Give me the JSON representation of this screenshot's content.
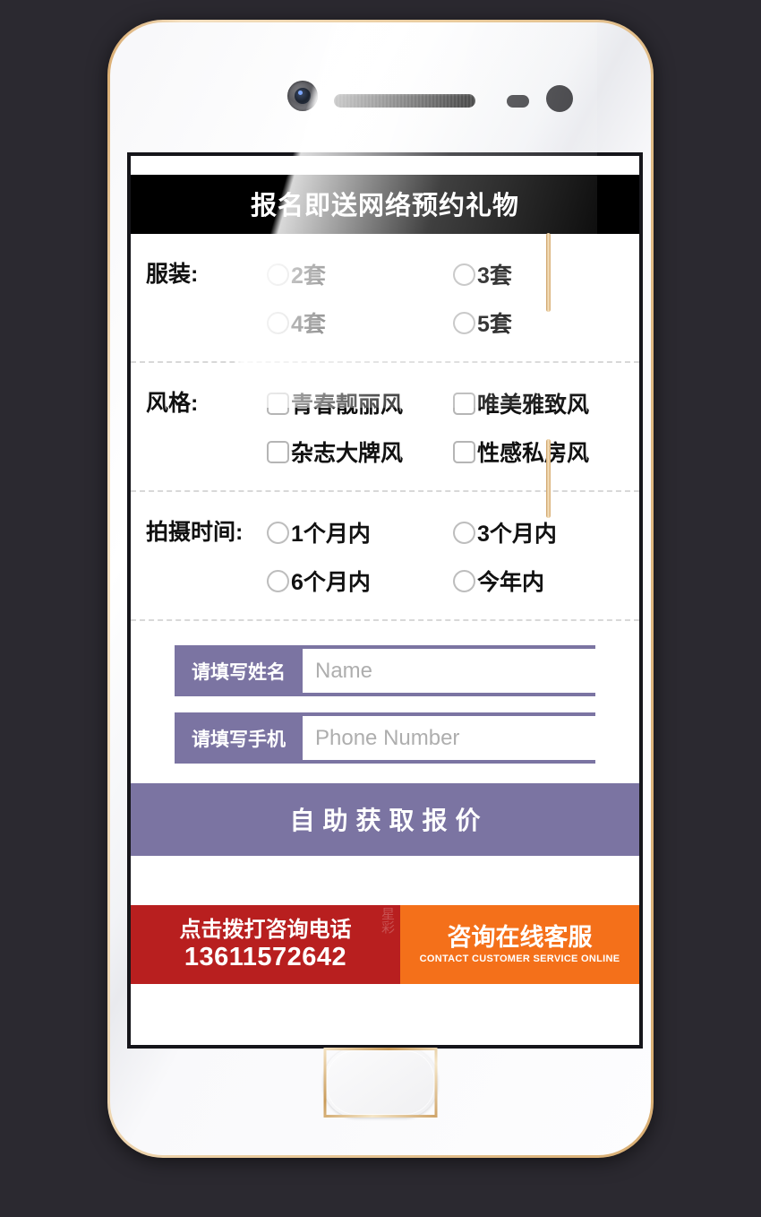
{
  "device": {
    "name": "white-gold-smartphone",
    "icons": {
      "front_camera": "camera-icon",
      "earpiece": "speaker-grille-icon",
      "proximity_sensor": "proximity-sensor-icon",
      "light_sensor": "light-sensor-icon",
      "home_button": "home-button-icon",
      "volume_up": "volume-up-button",
      "volume_down": "volume-down-button"
    }
  },
  "screen": {
    "header": {
      "title": "报名即送网络预约礼物"
    },
    "sections": [
      {
        "label": "服装:",
        "type": "radio",
        "options": [
          "2套",
          "3套",
          "4套",
          "5套"
        ]
      },
      {
        "label": "风格:",
        "type": "checkbox",
        "options": [
          "青春靓丽风",
          "唯美雅致风",
          "杂志大牌风",
          "性感私房风"
        ]
      },
      {
        "label": "拍摄时间:",
        "type": "radio",
        "options": [
          "1个月内",
          "3个月内",
          "6个月内",
          "今年内"
        ]
      }
    ],
    "inputs": [
      {
        "tag": "请填写姓名",
        "placeholder": "Name",
        "value": ""
      },
      {
        "tag": "请填写手机",
        "placeholder": "Phone Number",
        "value": ""
      }
    ],
    "submit": {
      "label": "自助获取报价"
    },
    "contact_bar": {
      "call": {
        "title": "点击拨打咨询电话",
        "phone": "13611572642",
        "color": "#b81f1f"
      },
      "online_service": {
        "title": "咨询在线客服",
        "subtitle": "CONTACT CUSTOMER SERVICE ONLINE",
        "color": "#f4701a"
      },
      "watermark": "星彩"
    }
  },
  "theme": {
    "accent_purple": "#7b74a2",
    "header_black": "#000000",
    "page_background": "#2b2930",
    "call_red": "#b81f1f",
    "service_orange": "#f4701a"
  }
}
